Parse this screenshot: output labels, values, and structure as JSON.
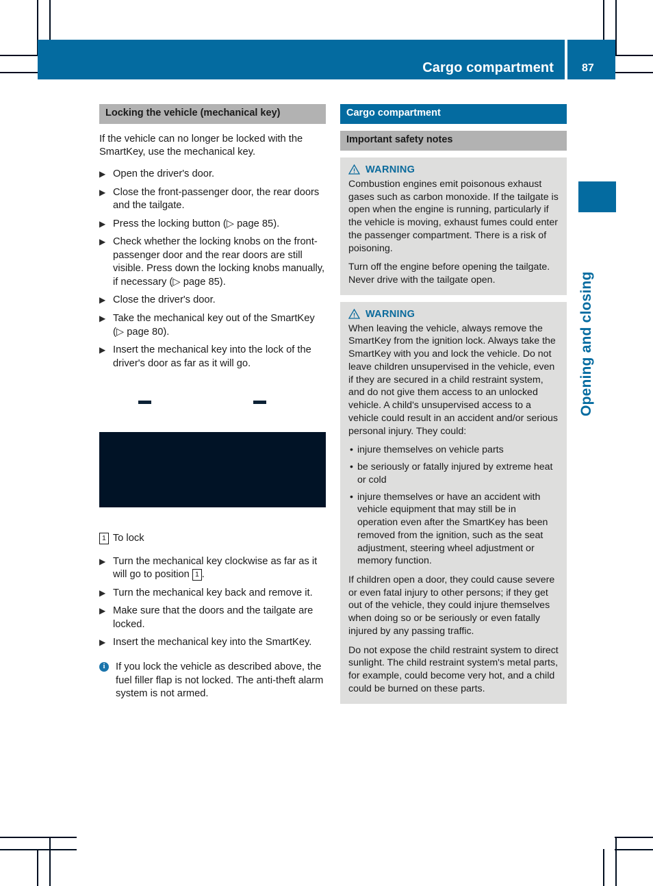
{
  "header": {
    "title": "Cargo compartment",
    "page_number": "87"
  },
  "chapter_tab": {
    "label": "Opening and closing"
  },
  "left_column": {
    "heading": "Locking the vehicle (mechanical key)",
    "intro": "If the vehicle can no longer be locked with the SmartKey, use the mechanical key.",
    "steps": [
      "Open the driver's door.",
      "Close the front-passenger door, the rear doors and the tailgate.",
      "Press the locking button (▷ page 85).",
      "Check whether the locking knobs on the front-passenger door and the rear doors are still visible. Press down the locking knobs manually, if necessary (▷ page 85).",
      "Close the driver's door.",
      "Take the mechanical key out of the SmartKey (▷ page 80).",
      "Insert the mechanical key into the lock of the driver's door as far as it will go."
    ],
    "figure_caption_number": "1",
    "figure_caption_text": "To lock",
    "steps2_a_pre": "Turn the mechanical key clockwise as far as it will go to position",
    "steps2_a_callout": "1",
    "steps2_a_post": ".",
    "steps2_rest": [
      "Turn the mechanical key back and remove it.",
      "Make sure that the doors and the tailgate are locked.",
      "Insert the mechanical key into the SmartKey."
    ],
    "note": "If you lock the vehicle as described above, the fuel filler flap is not locked. The anti-theft alarm system is not armed.",
    "note_icon": "info-icon"
  },
  "right_column": {
    "heading": "Cargo compartment",
    "subheading": "Important safety notes",
    "warnings": [
      {
        "label": "WARNING",
        "icon": "warning-triangle-icon",
        "paragraphs": [
          "Combustion engines emit poisonous exhaust gases such as carbon monoxide. If the tailgate is open when the engine is running, particularly if the vehicle is moving, exhaust fumes could enter the passenger compartment. There is a risk of poisoning.",
          "Turn off the engine before opening the tailgate. Never drive with the tailgate open."
        ],
        "bullets": [],
        "paragraphs_after": []
      },
      {
        "label": "WARNING",
        "icon": "warning-triangle-icon",
        "paragraphs": [
          "When leaving the vehicle, always remove the SmartKey from the ignition lock. Always take the SmartKey with you and lock the vehicle. Do not leave children unsupervised in the vehicle, even if they are secured in a child restraint system, and do not give them access to an unlocked vehicle. A child's unsupervised access to a vehicle could result in an accident and/or serious personal injury. They could:"
        ],
        "bullets": [
          "injure themselves on vehicle parts",
          "be seriously or fatally injured by extreme heat or cold",
          "injure themselves or have an accident with vehicle equipment that may still be in operation even after the SmartKey has been removed from the ignition, such as the seat adjustment, steering wheel adjustment or memory function."
        ],
        "paragraphs_after": [
          "If children open a door, they could cause severe or even fatal injury to other persons; if they get out of the vehicle, they could injure themselves when doing so or be seriously or even fatally injured by any passing traffic.",
          "Do not expose the child restraint system to direct sunlight. The child restraint system's metal parts, for example, could become very hot, and a child could be burned on these parts."
        ]
      }
    ]
  },
  "colors": {
    "brand_blue": "#046ba0",
    "heading_gray": "#b2b2b2",
    "warning_bg": "#dededd",
    "warning_blue": "#0a6a9c",
    "image_dark": "#011326"
  }
}
